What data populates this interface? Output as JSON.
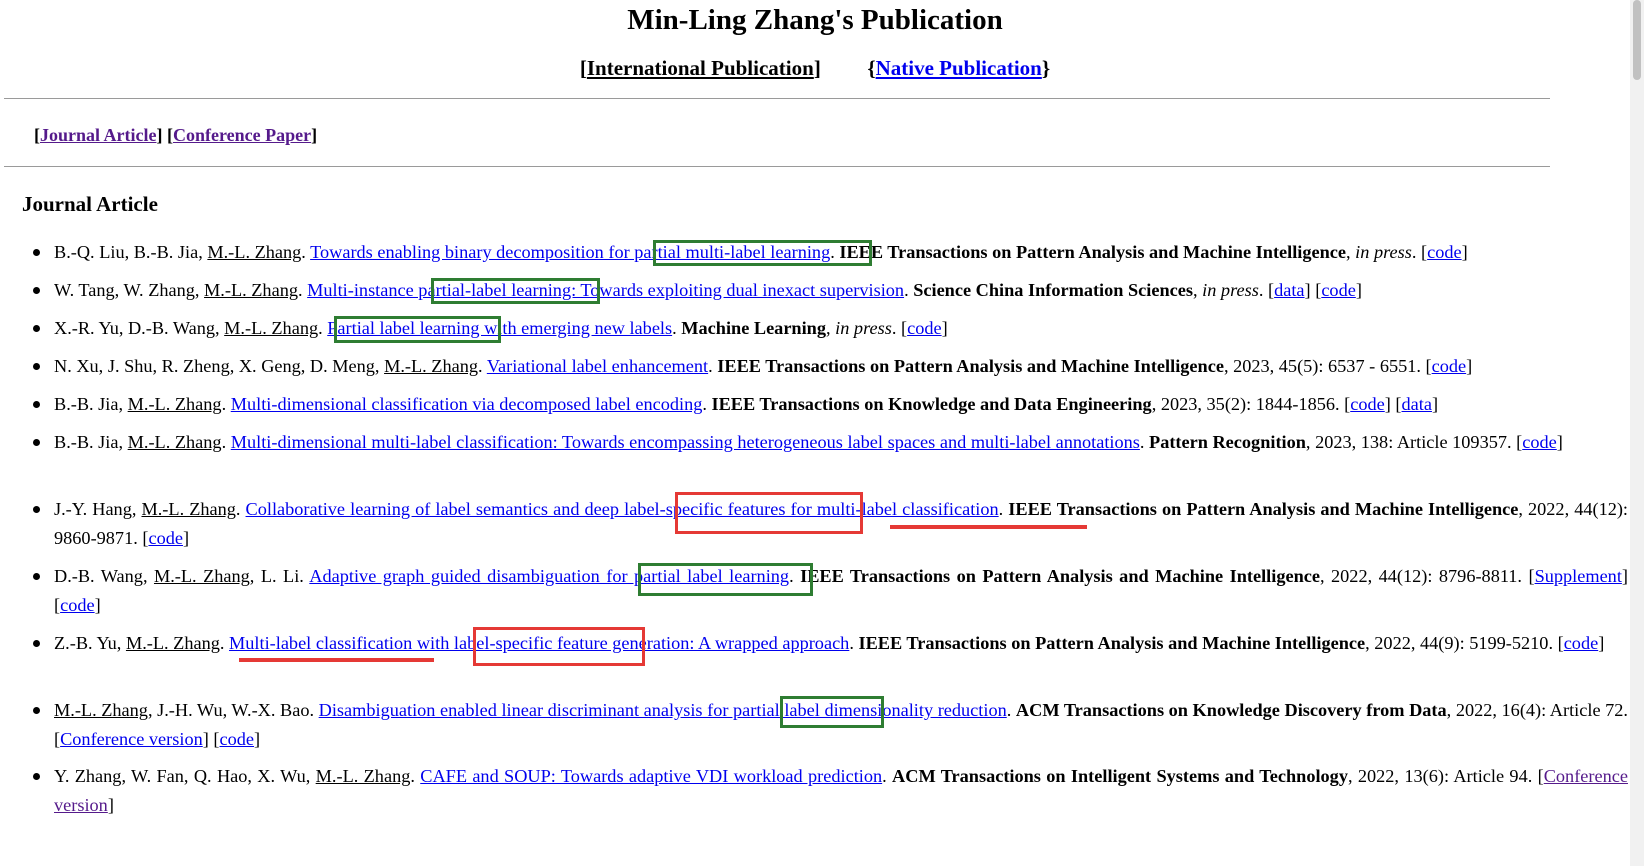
{
  "title": "Min-Ling Zhang's Publication",
  "top_nav": {
    "international_label": "International Publication",
    "native_label": "Native Publication"
  },
  "sub_nav": {
    "journal_label": "Journal Article",
    "conference_label": "Conference Paper"
  },
  "section_heading": "Journal Article",
  "publications": [
    {
      "authors_pre": "B.-Q. Liu, B.-B. Jia, ",
      "self": "M.-L. Zhang",
      "authors_post": ". ",
      "title": "Towards enabling binary decomposition for partial multi-label learning",
      "venue": "IEEE Transactions on Pattern Analysis and Machine Intelligence",
      "details_pre": ", ",
      "in_press": "in press",
      "details": ". ",
      "links": [
        "code"
      ]
    },
    {
      "authors_pre": "W. Tang, W. Zhang, ",
      "self": "M.-L. Zhang",
      "authors_post": ". ",
      "title": "Multi-instance partial-label learning: Towards exploiting dual inexact supervision",
      "venue": "Science China Information Sciences",
      "details_pre": ", ",
      "in_press": "in press",
      "details": ". ",
      "links": [
        "data",
        "code"
      ]
    },
    {
      "authors_pre": "X.-R. Yu, D.-B. Wang, ",
      "self": "M.-L. Zhang",
      "authors_post": ". ",
      "title": "Partial label learning with emerging new labels",
      "venue": "Machine Learning",
      "details_pre": ", ",
      "in_press": "in press",
      "details": ". ",
      "links": [
        "code"
      ]
    },
    {
      "authors_pre": "N. Xu, J. Shu, R. Zheng, X. Geng, D. Meng, ",
      "self": "M.-L. Zhang",
      "authors_post": ". ",
      "title": "Variational label enhancement",
      "venue": "IEEE Transactions on Pattern Analysis and Machine Intelligence",
      "details_pre": "",
      "in_press": "",
      "details": ", 2023, 45(5): 6537 - 6551. ",
      "links": [
        "code"
      ]
    },
    {
      "authors_pre": "B.-B. Jia, ",
      "self": "M.-L. Zhang",
      "authors_post": ". ",
      "title": "Multi-dimensional classification via decomposed label encoding",
      "venue": "IEEE Transactions on Knowledge and Data Engineering",
      "details_pre": "",
      "in_press": "",
      "details": ", 2023, 35(2): 1844-1856. ",
      "links": [
        "code",
        "data"
      ]
    },
    {
      "authors_pre": "B.-B. Jia, ",
      "self": "M.-L. Zhang",
      "authors_post": ". ",
      "title": "Multi-dimensional multi-label classification: Towards encompassing heterogeneous label spaces and multi-label annotations",
      "venue": "Pattern Recognition",
      "details_pre": "",
      "in_press": "",
      "details": ", 2023, 138: Article 109357. ",
      "links": [
        "code"
      ]
    },
    {
      "authors_pre": "J.-Y. Hang, ",
      "self": "M.-L. Zhang",
      "authors_post": ". ",
      "title": "Collaborative learning of label semantics and deep label-specific features for multi-label classification",
      "venue": "IEEE Transactions on Pattern Analysis and Machine Intelligence",
      "details_pre": "",
      "in_press": "",
      "details": ", 2022, 44(12): 9860-9871. ",
      "links": [
        "code"
      ]
    },
    {
      "authors_pre": "D.-B. Wang, ",
      "self": "M.-L. Zhang",
      "authors_post": ", L. Li. ",
      "title": "Adaptive graph guided disambiguation for partial label learning",
      "venue": "IEEE Transactions on Pattern Analysis and Machine Intelligence",
      "details_pre": "",
      "in_press": "",
      "details": ", 2022, 44(12): 8796-8811. ",
      "links": [
        "Supplement",
        "code"
      ]
    },
    {
      "authors_pre": "Z.-B. Yu, ",
      "self": "M.-L. Zhang",
      "authors_post": ". ",
      "title": "Multi-label classification with label-specific feature generation: A wrapped approach",
      "venue": "IEEE Transactions on Pattern Analysis and Machine Intelligence",
      "details_pre": "",
      "in_press": "",
      "details": ", 2022, 44(9): 5199-5210. ",
      "links": [
        "code"
      ]
    },
    {
      "authors_pre": "",
      "self": "M.-L. Zhang",
      "authors_post": ", J.-H. Wu, W.-X. Bao. ",
      "title": "Disambiguation enabled linear discriminant analysis for partial label dimensionality reduction",
      "venue": "ACM Transactions on Knowledge Discovery from Data",
      "details_pre": "",
      "in_press": "",
      "details": ", 2022, 16(4): Article 72. ",
      "links": [
        "Conference version",
        "code"
      ]
    },
    {
      "authors_pre": "Y. Zhang, W. Fan, Q. Hao, X. Wu, ",
      "self": "M.-L. Zhang",
      "authors_post": ". ",
      "title": "CAFE and SOUP: Towards adaptive VDI workload prediction",
      "venue": "ACM Transactions on Intelligent Systems and Technology",
      "details_pre": "",
      "in_press": "",
      "details": ", 2022, 13(6): Article 94. ",
      "links": [
        "Conference version"
      ]
    }
  ],
  "colors": {
    "link": "#0000ee",
    "visited_link": "#551a8b",
    "highlight_green": "#2e7d32",
    "highlight_red": "#e53935"
  }
}
